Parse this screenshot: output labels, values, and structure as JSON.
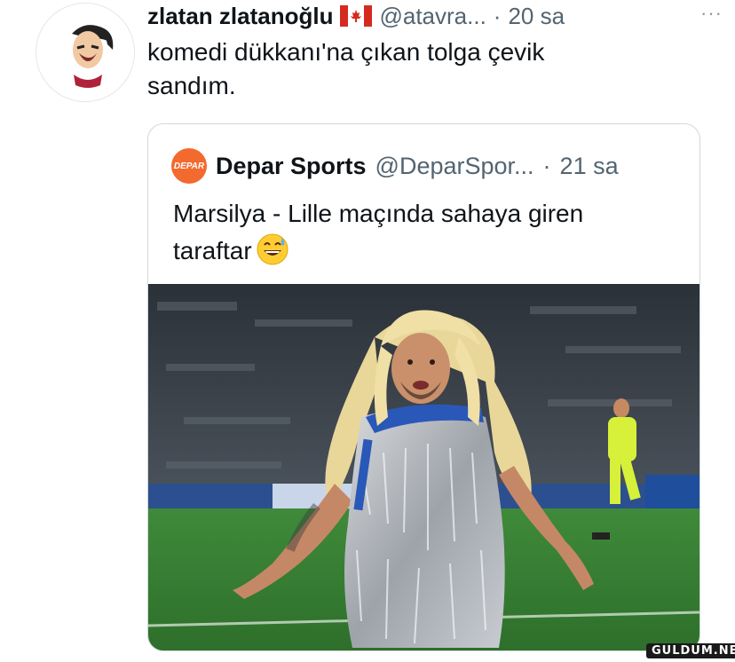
{
  "tweet": {
    "author_name": "zlatan zlatanoğlu",
    "author_handle": "@atavra...",
    "separator": "·",
    "time": "20 sa",
    "more": "···",
    "text": "komedi dükkanı'na çıkan tolga çevik\nsandım.",
    "flag_icon": "canada-flag-icon",
    "avatar_icon": "cartoon-footballer-avatar"
  },
  "quoted": {
    "author_name": "Depar Sports",
    "author_handle": "@DeparSpor...",
    "separator": "·",
    "time": "21 sa",
    "avatar_text": "DEPAR",
    "text": "Marsilya - Lille maçında sahaya giren\ntaraftar",
    "emoji_icon": "grinning-sweat-emoji-icon",
    "brand_color": "#f36a2e"
  },
  "watermark": "GULDUM.NET"
}
